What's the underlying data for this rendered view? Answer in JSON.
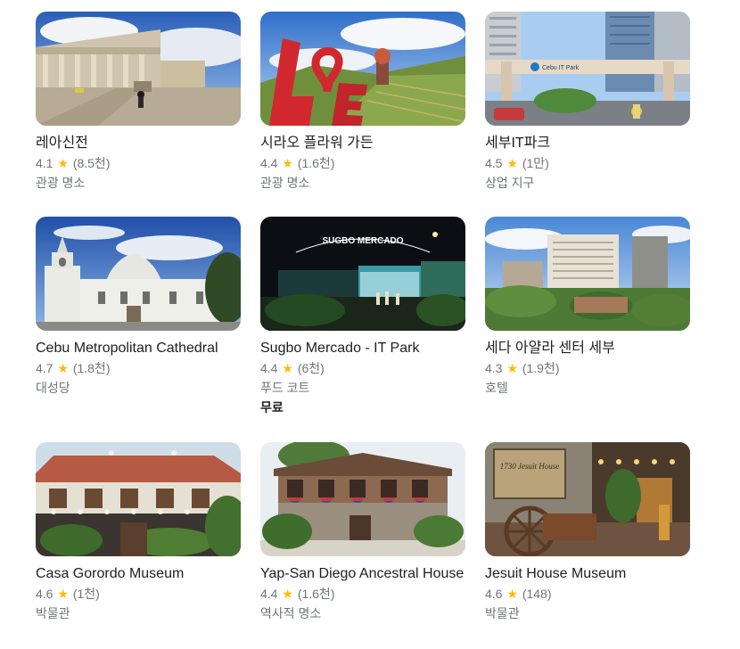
{
  "places": [
    {
      "title": "레아신전",
      "rating": "4.1",
      "reviews": "(8.5천)",
      "category": "관광 명소",
      "extra": ""
    },
    {
      "title": "시라오 플라워 가든",
      "rating": "4.4",
      "reviews": "(1.6천)",
      "category": "관광 명소",
      "extra": ""
    },
    {
      "title": "세부IT파크",
      "rating": "4.5",
      "reviews": "(1만)",
      "category": "상업 지구",
      "extra": ""
    },
    {
      "title": "Cebu Metropolitan Cathedral",
      "rating": "4.7",
      "reviews": "(1.8천)",
      "category": "대성당",
      "extra": ""
    },
    {
      "title": "Sugbo Mercado - IT Park",
      "rating": "4.4",
      "reviews": "(6천)",
      "category": "푸드 코트",
      "extra": "무료"
    },
    {
      "title": "세다 아얄라 센터 세부",
      "rating": "4.3",
      "reviews": "(1.9천)",
      "category": "호텔",
      "extra": ""
    },
    {
      "title": "Casa Gorordo Museum",
      "rating": "4.6",
      "reviews": "(1천)",
      "category": "박물관",
      "extra": ""
    },
    {
      "title": "Yap-San Diego Ancestral House",
      "rating": "4.4",
      "reviews": "(1.6천)",
      "category": "역사적 명소",
      "extra": ""
    },
    {
      "title": "Jesuit House Museum",
      "rating": "4.6",
      "reviews": "(148)",
      "category": "박물관",
      "extra": ""
    }
  ],
  "photo_texts": {
    "sugbo_sign": "SUGBO MERCADO",
    "it_park_gate": "Cebu IT Park",
    "jesuit_sign": "1730 Jesuit House"
  },
  "colors": {
    "star": "#fbbc04",
    "secondary_text": "#70757a",
    "primary_text": "#202124"
  },
  "icons": {
    "rating": "star-icon"
  }
}
